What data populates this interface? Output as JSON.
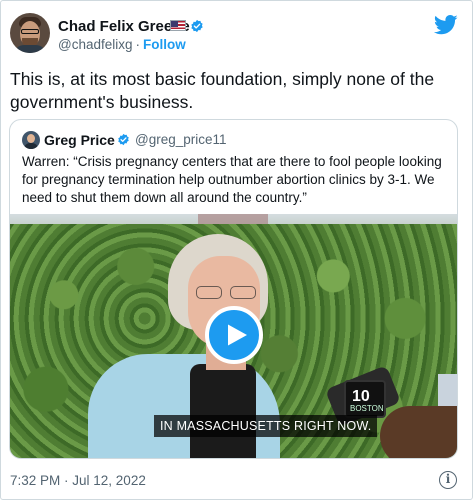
{
  "tweet": {
    "author": {
      "name": "Chad Felix Greene",
      "handle": "@chadfelixg",
      "follow_label": "Follow",
      "separator": "·",
      "flag_icon": "us-flag-icon",
      "verified_icon": "verified-badge-icon"
    },
    "text": "This is, at its most basic foundation, simply none of the government's business.",
    "timestamp": "7:32 PM · Jul 12, 2022",
    "brand_icon": "twitter-bird-icon",
    "info_icon": "info-icon",
    "info_glyph": "i",
    "colors": {
      "accent": "#1d9bf0",
      "text": "#0f1419",
      "secondary_text": "#536471",
      "border": "#cfd9de"
    }
  },
  "quoted_tweet": {
    "author": {
      "name": "Greg Price",
      "handle": "@greg_price11",
      "verified_icon": "verified-badge-icon"
    },
    "text": "Warren: “Crisis pregnancy centers that are there to fool people looking for pregnancy termination help outnumber abortion clinics by 3-1. We need to shut them down all around the country.”",
    "video": {
      "caption": "IN MASSACHUSETTS RIGHT NOW.",
      "play_icon": "play-icon",
      "mic_flag_number": "10",
      "mic_flag_text": "BOSTON"
    }
  }
}
